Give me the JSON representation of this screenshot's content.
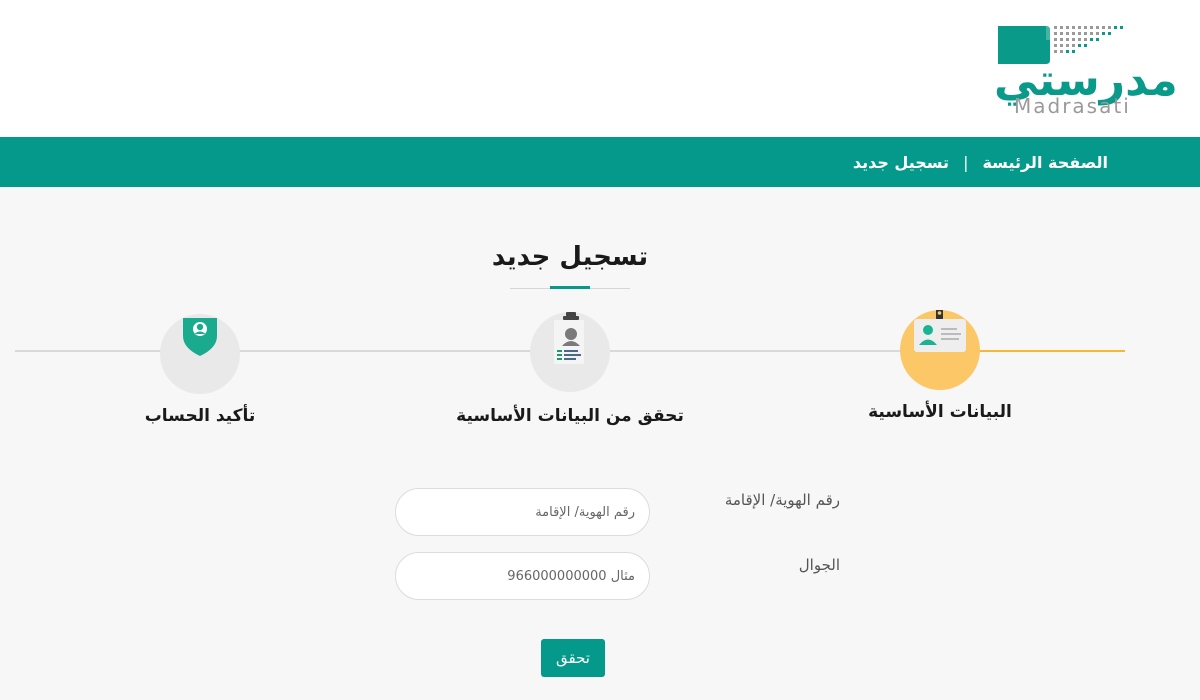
{
  "logo": {
    "arabic": "مدرستي",
    "english": "Madrasati"
  },
  "breadcrumb": {
    "home": "الصفحة الرئيسة",
    "separator": "|",
    "current": "تسجيل جديد"
  },
  "page": {
    "title": "تسجيل جديد"
  },
  "steps": [
    {
      "label": "البيانات الأساسية",
      "icon": "id-card-icon",
      "state": "active"
    },
    {
      "label": "تحقق من البيانات الأساسية",
      "icon": "profile-badge-icon",
      "state": "pending"
    },
    {
      "label": "تأكيد الحساب",
      "icon": "shield-user-icon",
      "state": "pending"
    }
  ],
  "form": {
    "id_label": "رقم الهوية/ الإقامة",
    "id_placeholder": "رقم الهوية/ الإقامة",
    "id_value": "",
    "phone_label": "الجوال",
    "phone_placeholder": "مثال 966000000000",
    "phone_value": "",
    "submit_label": "تحقق"
  },
  "colors": {
    "primary": "#04998a",
    "active_step": "#fcc867",
    "progress": "#f7b733"
  }
}
